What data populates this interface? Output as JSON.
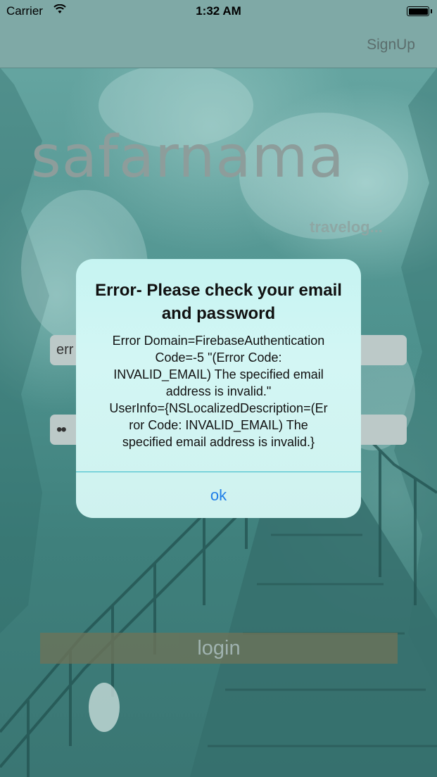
{
  "status_bar": {
    "carrier": "Carrier",
    "time": "1:32 AM"
  },
  "nav": {
    "signup_label": "SignUp"
  },
  "brand": {
    "logo": "safarnama",
    "tagline": "travelog..."
  },
  "form": {
    "email_value": "err",
    "password_value": "••",
    "login_label": "login"
  },
  "alert": {
    "title": "Error- Please check your email and password",
    "message_lines": [
      "Error Domain=FirebaseAuthentication",
      "Code=-5 \"(Error Code:",
      "INVALID_EMAIL) The specified email",
      "address is invalid.\"",
      "UserInfo={NSLocalizedDescription=(Er",
      "ror Code: INVALID_EMAIL) The",
      "specified email address is invalid.}"
    ],
    "ok_label": "ok"
  },
  "colors": {
    "accent": "#1f7ee8",
    "alert_background": "#c6f4f2",
    "navbar": "#7fa9a6"
  }
}
